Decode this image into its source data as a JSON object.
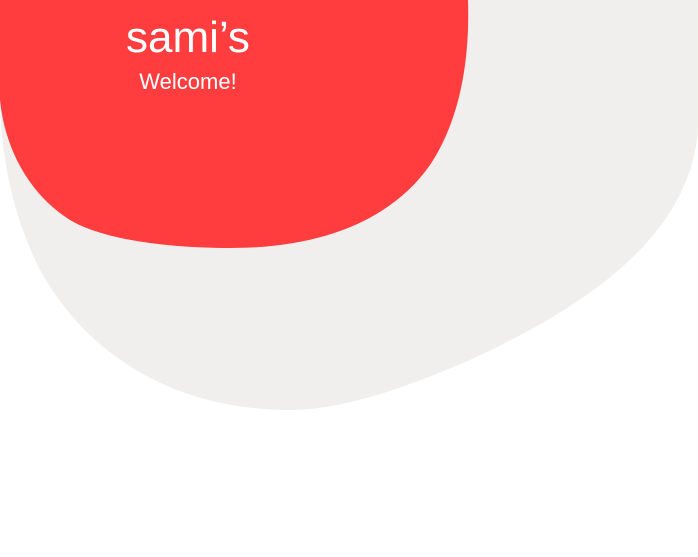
{
  "splash": {
    "brand_name": "sami’s",
    "greeting": "Welcome!"
  },
  "colors": {
    "background": "#ffffff",
    "back_blob": "#f1efee",
    "front_blob": "#ff3d3f",
    "text": "#ffffff"
  }
}
